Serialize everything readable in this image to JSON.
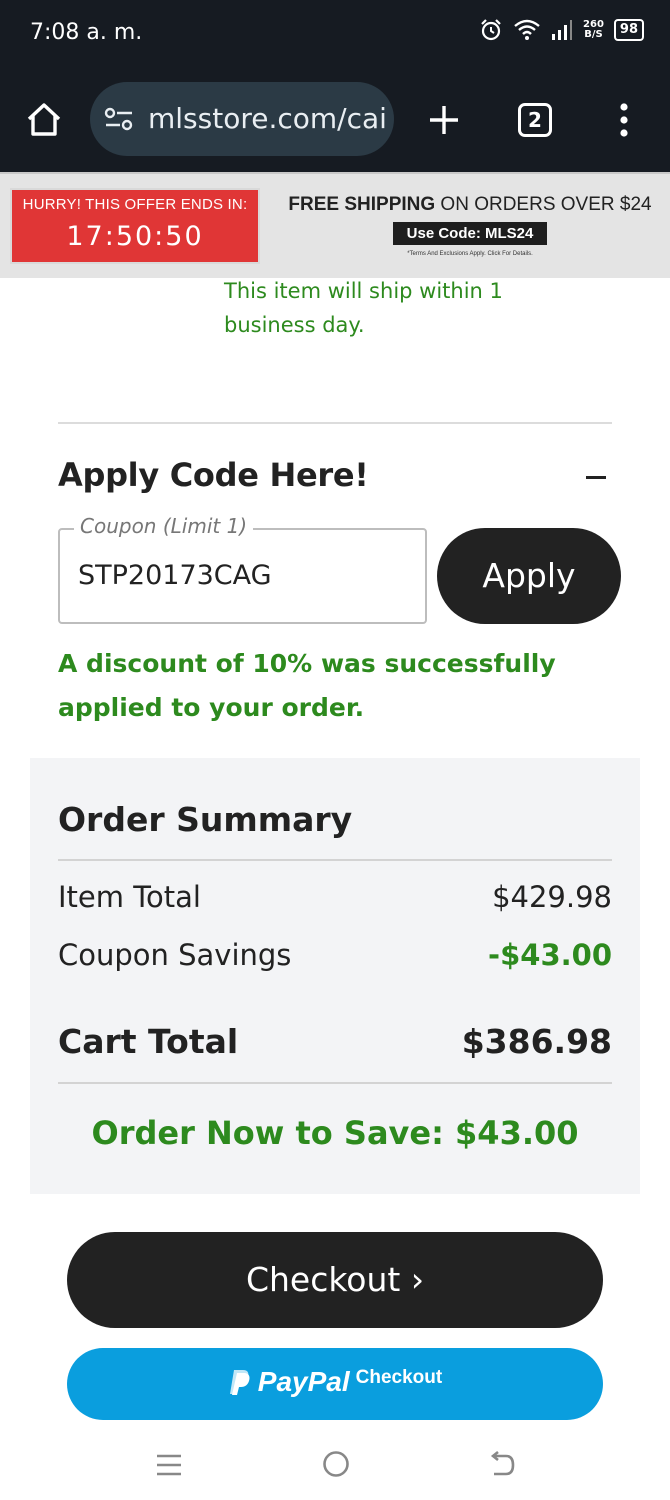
{
  "status_bar": {
    "time": "7:08 a. m.",
    "net_speed_value": "260",
    "net_speed_unit": "B/S",
    "battery": "98"
  },
  "browser": {
    "url": "mlsstore.com/cai",
    "tab_count": "2"
  },
  "promo": {
    "hurry_label": "HURRY! THIS OFFER ENDS IN:",
    "countdown": "17:50:50",
    "free_shipping_bold": "FREE SHIPPING",
    "free_shipping_rest": " ON ORDERS OVER $24",
    "use_code": "Use Code: MLS24",
    "terms": "*Terms And Exclusions Apply. Click For Details."
  },
  "ship_note": "This item will ship within 1 business day.",
  "coupon": {
    "section_title": "Apply Code Here!",
    "field_label": "Coupon (Limit 1)",
    "field_value": "STP20173CAG",
    "apply_label": "Apply",
    "success_message": "A discount of 10% was successfully applied to your order."
  },
  "summary": {
    "title": "Order Summary",
    "item_total_label": "Item Total",
    "item_total_value": "$429.98",
    "coupon_savings_label": "Coupon Savings",
    "coupon_savings_value": "-$43.00",
    "cart_total_label": "Cart Total",
    "cart_total_value": "$386.98",
    "save_message": "Order Now to Save: $43.00"
  },
  "buttons": {
    "checkout": "Checkout ›",
    "paypal_word": "PayPal",
    "paypal_checkout": "Checkout"
  },
  "colors": {
    "green": "#2d8a1e",
    "dark": "#222222",
    "paypal_blue": "#0a9ede",
    "timer_red": "#e03636"
  }
}
